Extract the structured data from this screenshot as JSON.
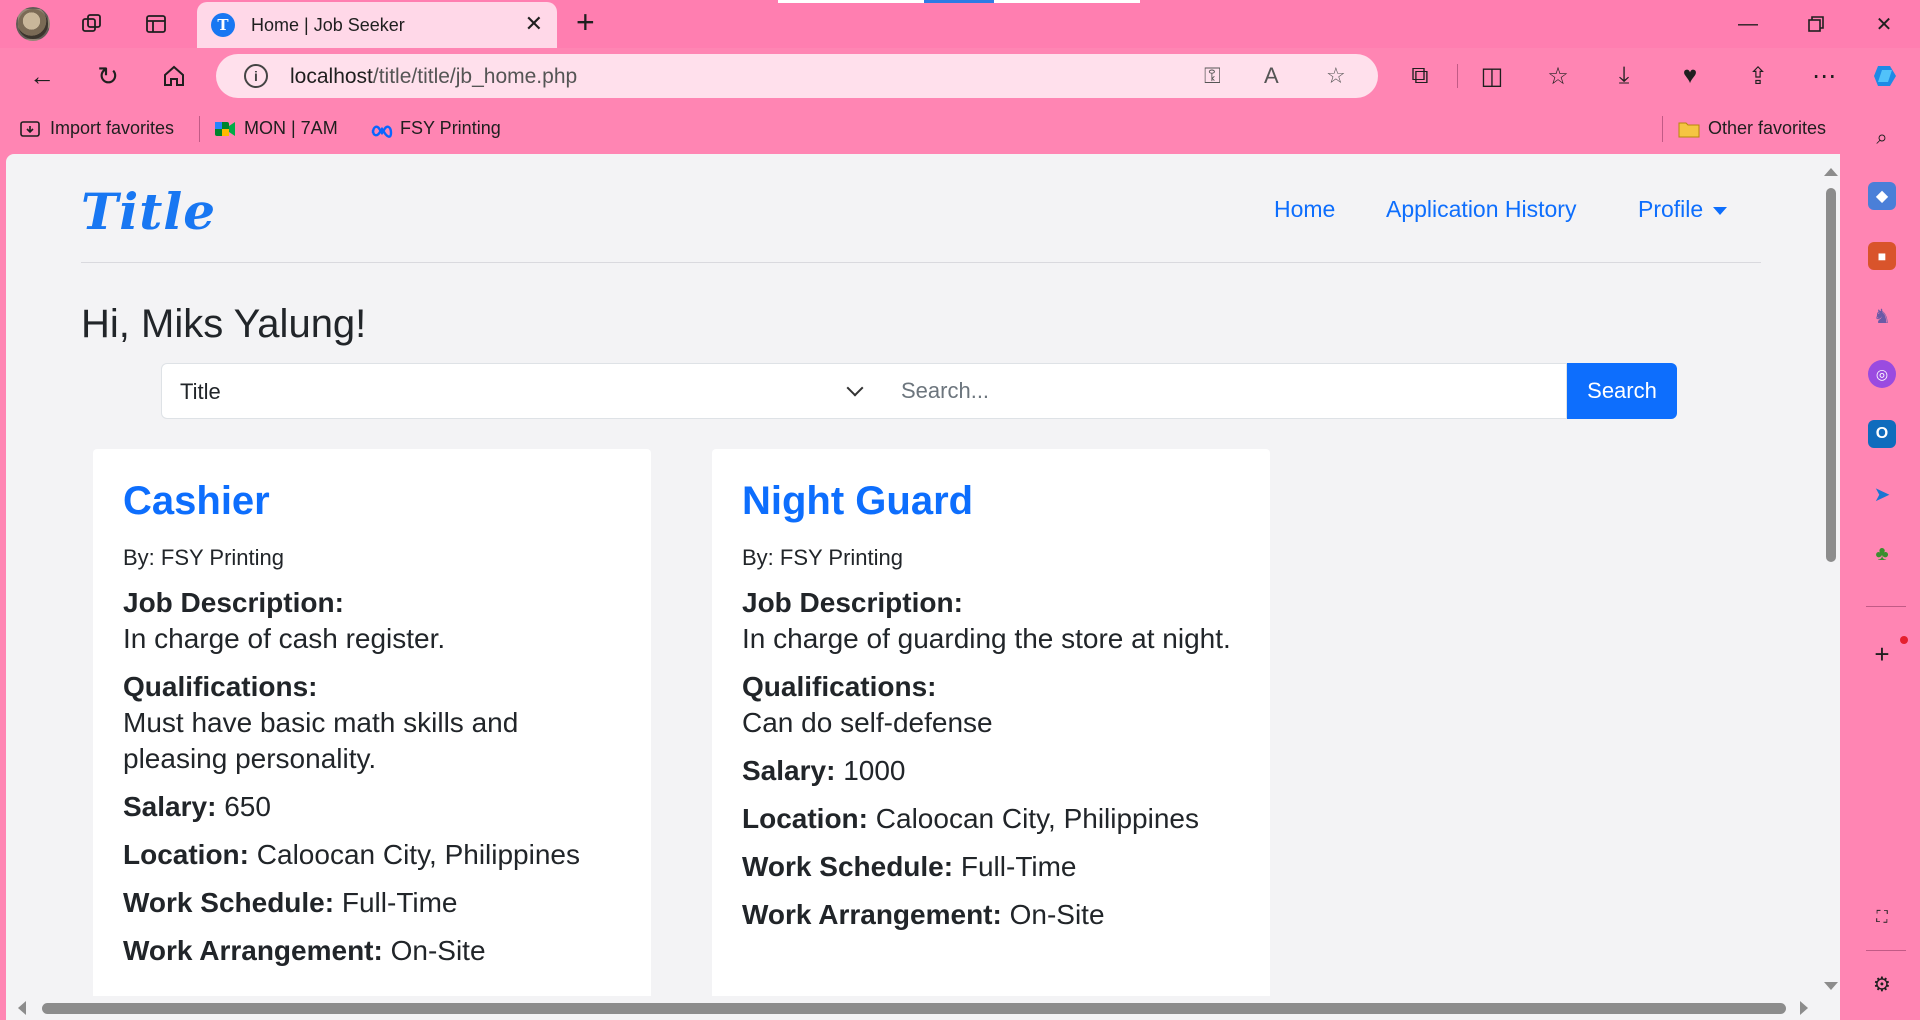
{
  "browser": {
    "tab_title": "Home | Job Seeker",
    "url_host": "localhost",
    "url_path": "/title/title/jb_home.php",
    "bookmarks": {
      "import": "Import favorites",
      "mon": "MON | 7AM",
      "fsy": "FSY Printing",
      "other": "Other favorites"
    }
  },
  "site": {
    "brand": "Title",
    "nav": {
      "home": "Home",
      "history": "Application History",
      "profile": "Profile"
    },
    "greeting": "Hi, Miks Yalung!",
    "search": {
      "filter_value": "Title",
      "placeholder": "Search...",
      "button": "Search"
    },
    "labels": {
      "desc": "Job Description:",
      "qual": "Qualifications:",
      "salary": "Salary:",
      "location": "Location:",
      "schedule": "Work Schedule:",
      "arrangement": "Work Arrangement:"
    },
    "jobs": [
      {
        "title": "Cashier",
        "by": "By: FSY Printing",
        "description": "In charge of cash register.",
        "qualifications": "Must have basic math skills and pleasing personality.",
        "salary": "650",
        "location": "Caloocan City, Philippines",
        "schedule": "Full-Time",
        "arrangement": "On-Site"
      },
      {
        "title": "Night Guard",
        "by": "By: FSY Printing",
        "description": "In charge of guarding the store at night.",
        "qualifications": "Can do self-defense",
        "salary": "1000",
        "location": "Caloocan City, Philippines",
        "schedule": "Full-Time",
        "arrangement": "On-Site"
      }
    ]
  },
  "colors": {
    "chrome": "#ff85b3",
    "primary": "#0d6efd",
    "brand": "#1877f2"
  }
}
